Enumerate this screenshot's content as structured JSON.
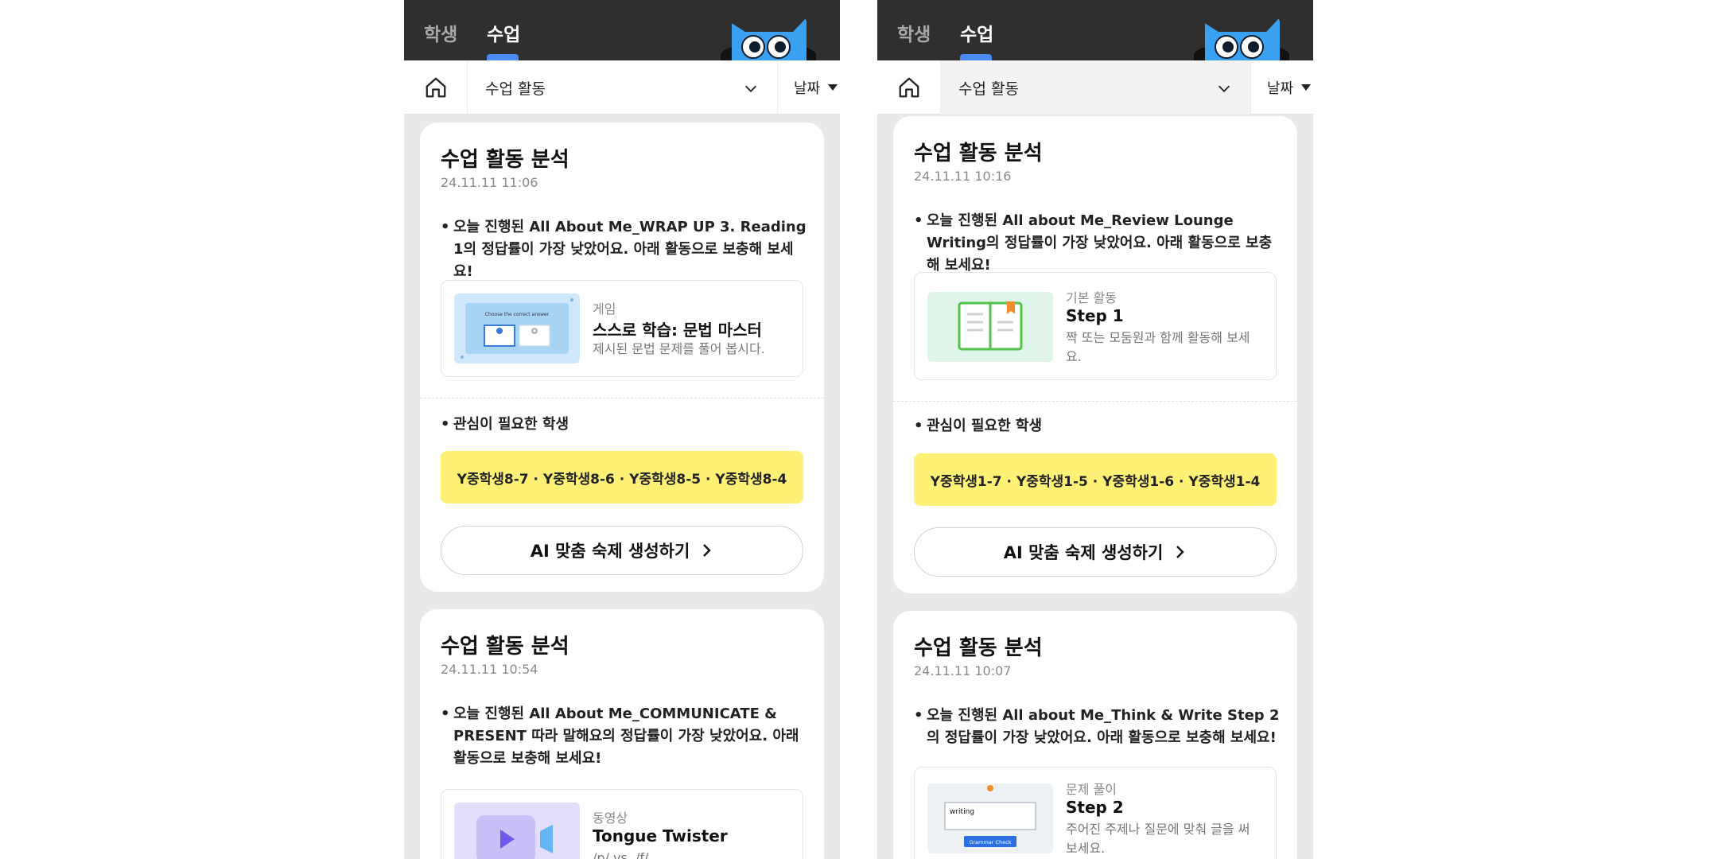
{
  "screens": [
    {
      "header": {
        "tabs": [
          "학생",
          "수업"
        ],
        "active_tab": "수업"
      },
      "filter": {
        "select_value": "수업 활동",
        "date_label": "날짜"
      },
      "cards": [
        {
          "title": "수업 활동 분석",
          "time": "24.11.11 11:06",
          "message": "오늘 진행된 All About Me_WRAP UP 3. Reading 1의 정답률이 가장 낮았어요. 아래 활동으로 보충해 보세요!",
          "activity": {
            "category": "게임",
            "title": "스스로 학습: 문법 마스터",
            "desc": "제시된 문법 문제를 풀어 봅시다.",
            "thumb_caption": "Choose the correct answer",
            "thumb_type": "game"
          },
          "students_label": "관심이 필요한 학생",
          "students": "Y중학생8-7 · Y중학생8-6 · Y중학생8-5 · Y중학생8-4",
          "ai_button": "AI 맞춤 숙제 생성하기"
        },
        {
          "title": "수업 활동 분석",
          "time": "24.11.11 10:54",
          "message": "오늘 진행된 All About Me_COMMUNICATE & PRESENT 따라 말해요의 정답률이 가장 낮았어요. 아래 활동으로 보충해 보세요!",
          "activity": {
            "category": "동영상",
            "title": "Tongue Twister",
            "desc": "/p/ vs. /f/",
            "thumb_type": "video"
          }
        }
      ]
    },
    {
      "header": {
        "tabs": [
          "학생",
          "수업"
        ],
        "active_tab": "수업"
      },
      "filter": {
        "select_value": "수업 활동",
        "date_label": "날짜"
      },
      "cards": [
        {
          "title": "수업 활동 분석",
          "time": "24.11.11 10:16",
          "message": "오늘 진행된 All about Me_Review Lounge Writing의 정답률이 가장 낮았어요. 아래 활동으로 보충해 보세요!",
          "activity": {
            "category": "기본 활동",
            "title": "Step 1",
            "desc": "짝 또는 모둠원과 함께 활동해 보세요.",
            "thumb_type": "book"
          },
          "students_label": "관심이 필요한 학생",
          "students": "Y중학생1-7 · Y중학생1-5 · Y중학생1-6 · Y중학생1-4",
          "ai_button": "AI 맞춤 숙제 생성하기"
        },
        {
          "title": "수업 활동 분석",
          "time": "24.11.11 10:07",
          "message": "오늘 진행된 All about Me_Think & Write Step 2의 정답률이 가장 낮았어요. 아래 활동으로 보충해 보세요!",
          "activity": {
            "category": "문제 풀이",
            "title": "Step 2",
            "desc": "주어진 주제나 질문에 맞춰 글을 써 보세요.",
            "thumb_word": "writing",
            "thumb_button": "Grammar Check",
            "thumb_type": "writing"
          }
        }
      ]
    }
  ],
  "colors": {
    "topbar": "#2f2f2f",
    "accent": "#4c8bf5",
    "highlight": "#fff176",
    "background": "#e9e9e9"
  }
}
